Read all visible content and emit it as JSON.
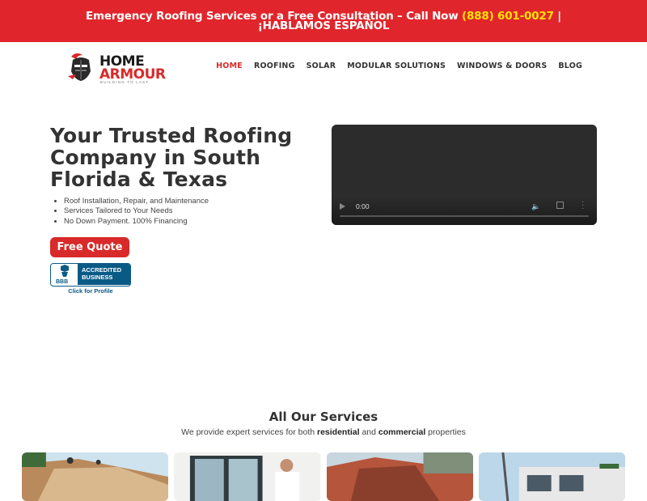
{
  "banner": {
    "text_before": "Emergency Roofing Services or a Free Consultation – Call Now ",
    "phone": "(888) 601-0027",
    "text_after": " | ¡HABLAMOS ESPAÑOL"
  },
  "logo": {
    "word1": "HOME",
    "word2": "ARMOUR",
    "tagline": "BUILDING TO LAST"
  },
  "nav": {
    "items": [
      "HOME",
      "ROOFING",
      "SOLAR",
      "MODULAR SOLUTIONS",
      "WINDOWS & DOORS",
      "BLOG"
    ],
    "active": "HOME"
  },
  "hero": {
    "title": "Your Trusted Roofing Company in South Florida & Texas",
    "bullets": [
      "Roof Installation, Repair, and Maintenance",
      "Services Tailored to Your Needs",
      "No Down Payment. 100% Financing"
    ],
    "cta": "Free Quote"
  },
  "bbb": {
    "mark": "BBB",
    "badge_line1": "ACCREDITED",
    "badge_line2": "BUSINESS",
    "profile_link": "Click for Profile"
  },
  "video": {
    "time": "0:00",
    "progress": 0
  },
  "services": {
    "title": "All Our Services",
    "sub_before": "We provide expert services for both ",
    "sub_bold1": "residential",
    "sub_mid": " and ",
    "sub_bold2": "commercial",
    "sub_after": " properties"
  },
  "colors": {
    "brand_red": "#d82a2a",
    "banner_red": "#e0262c",
    "phone_yellow": "#ffe100",
    "bbb_blue": "#0a5a86"
  }
}
